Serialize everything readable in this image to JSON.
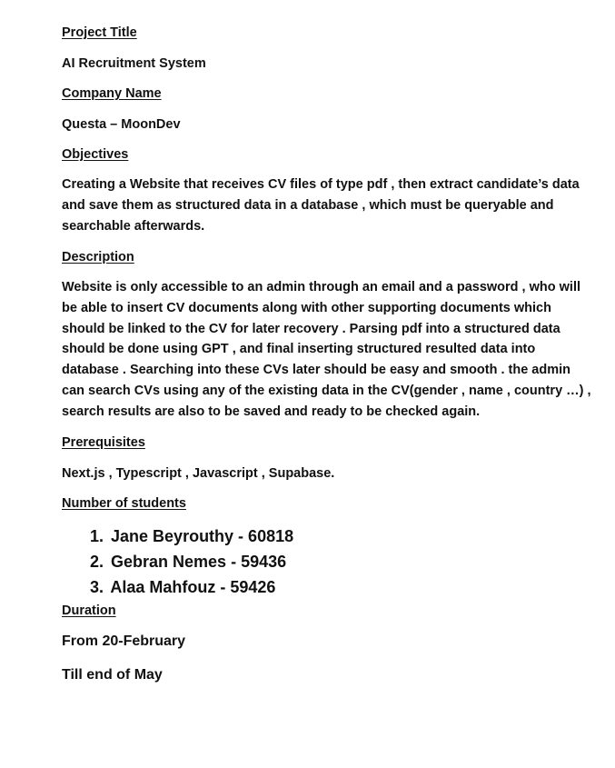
{
  "document": {
    "project_title": {
      "heading": "Project Title",
      "value": "AI Recruitment System"
    },
    "company_name": {
      "heading": "Company Name",
      "value": "Questa – MoonDev"
    },
    "objectives": {
      "heading": "Objectives",
      "lines": [
        "Creating a Website that receives CV files of type pdf , then extract candidate’s data",
        "and save them as structured data in a database , which must be queryable and",
        "searchable afterwards."
      ]
    },
    "description": {
      "heading": "Description",
      "lines": [
        "Website is only accessible to an admin through an email and a password , who will",
        "be able to insert CV documents along with other supporting documents which",
        "should be linked to the CV for later recovery . Parsing pdf into a structured data",
        "should be done using GPT , and final inserting structured resulted data into",
        "database . Searching into these CVs later should be easy and smooth . the admin",
        "can search CVs using any of the existing data in the CV(gender , name , country …) ,",
        "search results are also to be saved and ready to be checked again."
      ]
    },
    "prerequisites": {
      "heading": "Prerequisites",
      "value": "Next.js , Typescript , Javascript , Supabase."
    },
    "students": {
      "heading": "Number of students",
      "items": [
        {
          "number": "1.",
          "text": "Jane Beyrouthy - 60818"
        },
        {
          "number": "2.",
          "text": "Gebran Nemes - 59436"
        },
        {
          "number": "3.",
          "text": "Alaa Mahfouz - 59426"
        }
      ]
    },
    "duration": {
      "heading": "Duration",
      "from": "From 20-February",
      "till": "Till end of May"
    }
  }
}
